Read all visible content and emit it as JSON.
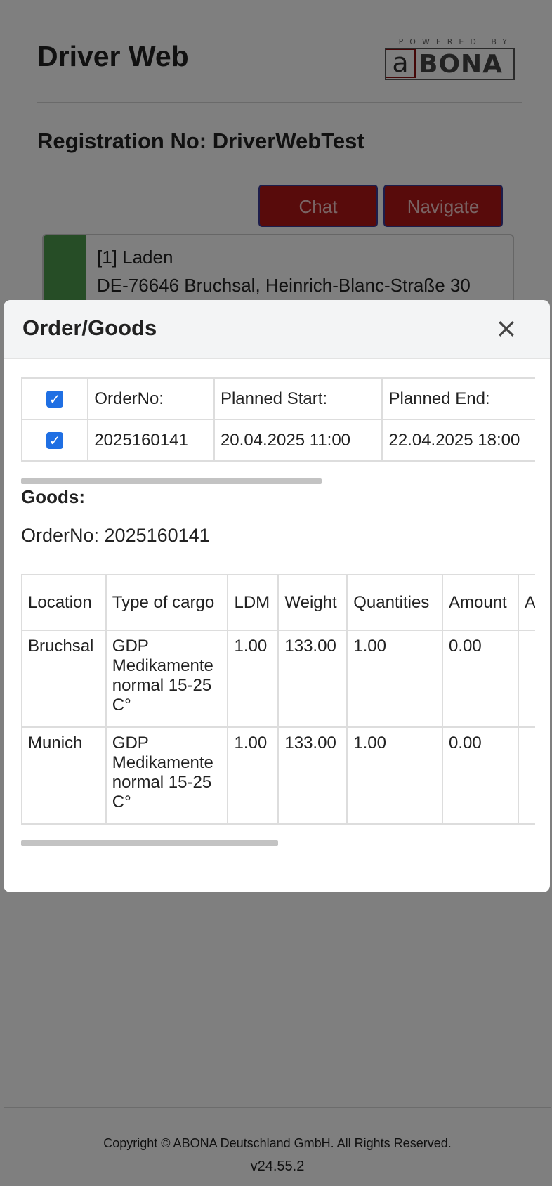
{
  "app": {
    "title": "Driver Web",
    "logo": {
      "powered_by": "POWERED BY",
      "brand_a": "a",
      "brand_rest": "BONA"
    },
    "registration": "Registration No: DriverWebTest"
  },
  "actions": {
    "chat_label": "Chat",
    "navigate_label": "Navigate"
  },
  "stop": {
    "line1": "[1] Laden",
    "line2": "DE-76646 Bruchsal, Heinrich-Blanc-Straße 30",
    "status_color": "#4c9a4c"
  },
  "footer": {
    "copyright": "Copyright © ABONA Deutschland GmbH. All Rights Reserved.",
    "version": "v24.55.2"
  },
  "modal": {
    "title": "Order/Goods",
    "close_symbol": "×",
    "orders_table": {
      "headers": [
        "OrderNo:",
        "Planned Start:",
        "Planned End:"
      ],
      "header_checked": true,
      "rows": [
        {
          "checked": true,
          "order_no": "2025160141",
          "planned_start": "20.04.2025 11:00",
          "planned_end": "22.04.2025 18:00"
        }
      ]
    },
    "goods": {
      "title": "Goods:",
      "order_line": "OrderNo: 2025160141",
      "headers": [
        "Location",
        "Type of cargo",
        "LDM",
        "Weight",
        "Quantities",
        "Amount",
        "A"
      ],
      "rows": [
        {
          "location": "Bruchsal",
          "type": "GDP Medikamente normal 15-25 C°",
          "ldm": "1.00",
          "weight": "133.00",
          "quantities": "1.00",
          "amount": "0.00",
          "extra": ""
        },
        {
          "location": "Munich",
          "type": "GDP Medikamente normal 15-25 C°",
          "ldm": "1.00",
          "weight": "133.00",
          "quantities": "1.00",
          "amount": "0.00",
          "extra": ""
        }
      ]
    }
  },
  "colors": {
    "button_bg": "#b01717",
    "button_border": "#3a3a96",
    "checkbox": "#1f6fe3"
  }
}
